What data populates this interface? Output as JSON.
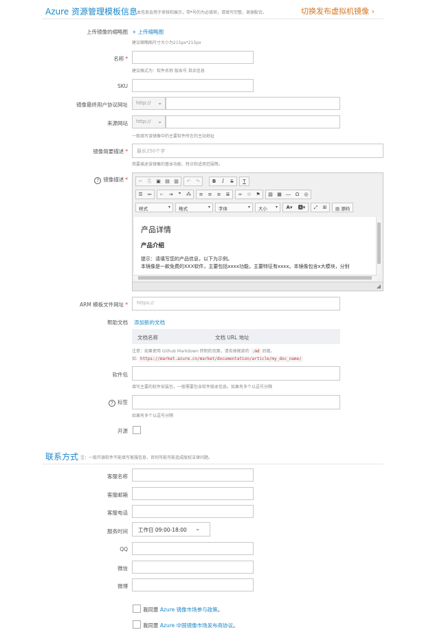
{
  "section1": {
    "title": "Azure 资源管理模板信息",
    "note_prefix": "本信息会用于审核和展示，带",
    "note_star": "*",
    "note_suffix": "号的为必填项，请填写完整，谢谢配合。",
    "switch_link": "切换发布虚拟机镜像 ›"
  },
  "thumbnail": {
    "label": "上传镜像的缩略图",
    "link": "+ 上传缩略图",
    "hint": "建议缩略图尺寸大小为215px*215px"
  },
  "name": {
    "label": "名称",
    "required": "*",
    "hint": "建议格式为：软件名称 版本号 其余信息"
  },
  "sku": {
    "label": "SKU"
  },
  "eula": {
    "label": "镜像最终用户协议网址",
    "protocol": "http://"
  },
  "source": {
    "label": "来源网站",
    "protocol": "http://",
    "hint": "一般填写该镜像中的主要软件所在的主站地址"
  },
  "short_desc": {
    "label": "镜像简要描述",
    "required": "*",
    "placeholder": "最长250个字",
    "hint": "简要描述该镜像的基本功能、特点和适用范围等。"
  },
  "long_desc": {
    "label": "镜像描述",
    "required": "*",
    "toolbar": {
      "combo_style": "样式",
      "combo_format": "格式",
      "combo_font": "字体",
      "combo_size": "大小",
      "source": "源码"
    },
    "content": {
      "h2": "产品详情",
      "h3": "产品介绍",
      "p1": "提示：请填写您的产品信息，以下为示例。",
      "p2": "本镜像是一款免费的XXX软件，主要包括xxxx功能，主要特征有xxxx。本镜像包含x大模块，分别"
    }
  },
  "arm": {
    "label": "ARM 模板文件网址",
    "required": "*",
    "placeholder": "https://"
  },
  "help_docs": {
    "label": "帮助文档",
    "add_link": "添加新的文档",
    "col_name": "文档名称",
    "col_url": "文档 URL 地址",
    "note_prefix": "注意：如果使用 Github Markdown 转制的页面，请去掉尾部的",
    "note_code": ".md",
    "note_suffix": "后缀。",
    "example_prefix": "如:",
    "example_code": "https://market.azure.cn/market/documentation/article/my_doc_name/"
  },
  "package": {
    "label": "软件包",
    "hint": "填写主要的软件安装包，一般需要包含软件版本信息。如果有多个以逗号分隔"
  },
  "tags": {
    "label": "标签",
    "hint": "如果有多个以逗号分隔"
  },
  "open_source": {
    "label": "开源"
  },
  "section2": {
    "title": "联系方式",
    "note": "注：一般开源软件不能填写客服信息，否则可能可能造成版权法律问题。"
  },
  "contact": {
    "cs_name": "客服名称",
    "cs_email": "客服邮箱",
    "cs_phone": "客服电话",
    "service_hours": "服务时间",
    "service_hours_value": "工作日 09:00-18:00",
    "qq": "QQ",
    "wechat": "微信",
    "weibo": "微博"
  },
  "agreements": {
    "a1_prefix": "我同意",
    "a1_link": "Azure 镜像市场参与政策",
    "a1_suffix": "。",
    "a2_prefix": "我同意",
    "a2_link": "Azure 中国镜像市场发布商协议",
    "a2_suffix": "。"
  }
}
